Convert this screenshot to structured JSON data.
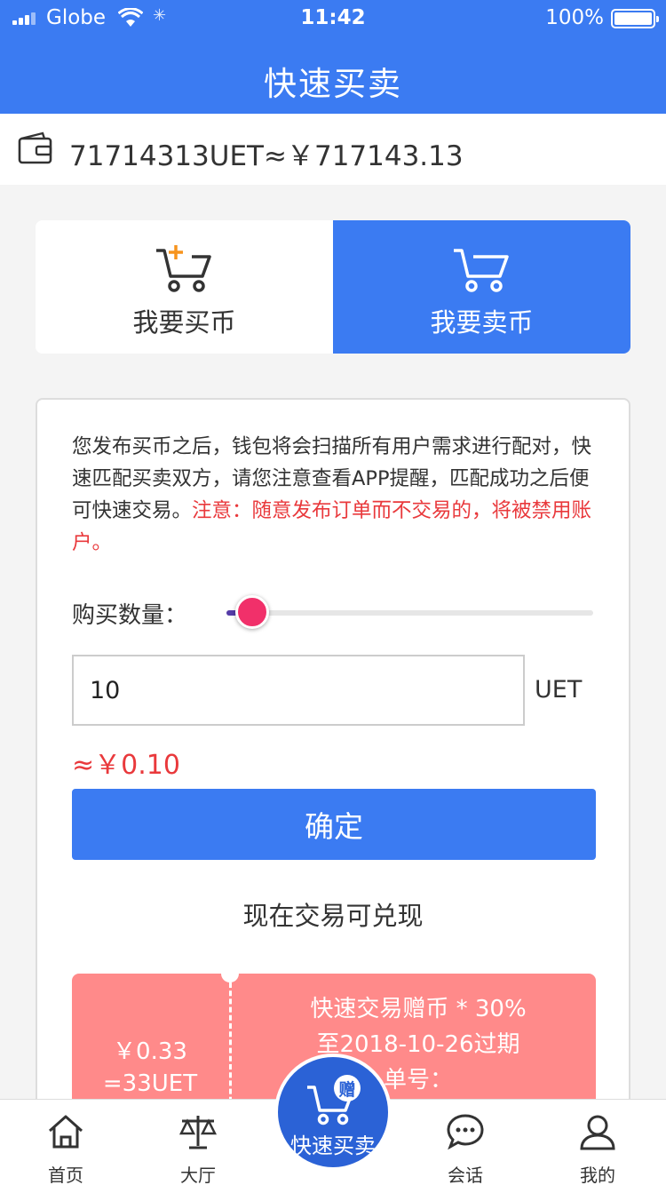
{
  "status_bar": {
    "carrier": "Globe",
    "time": "11:42",
    "battery": "100%"
  },
  "header": {
    "title": "快速买卖"
  },
  "wallet": {
    "balance": "71714313UET≈￥717143.13"
  },
  "tabs": [
    {
      "label": "我要买币"
    },
    {
      "label": "我要卖币"
    }
  ],
  "notice": {
    "text": "您发布买币之后，钱包将会扫描所有用户需求进行配对，快速匹配买卖双方，请您注意查看APP提醒，匹配成功之后便可快速交易。",
    "warning": "注意：随意发布订单而不交易的，将被禁用账户。"
  },
  "quantity": {
    "label": "购买数量：",
    "value": "10",
    "unit": "UET",
    "slider_fraction": 0.03,
    "estimate": "≈￥0.10"
  },
  "confirm_label": "确定",
  "hint": "现在交易可兑现",
  "coupon": {
    "left_line1": "￥0.33",
    "left_line2": "=33UET",
    "right_line1": "快速交易赠币 * 30%",
    "right_line2": "至2018-10-26过期",
    "right_line3": "单号："
  },
  "nav": [
    {
      "label": "首页"
    },
    {
      "label": "大厅"
    },
    {
      "label": "快速买卖",
      "badge": "赠"
    },
    {
      "label": "会话"
    },
    {
      "label": "我的"
    }
  ],
  "colors": {
    "primary": "#3b7bf2",
    "warning": "#e9393c",
    "coupon": "#ff8a8a",
    "knob": "#f1306a"
  }
}
